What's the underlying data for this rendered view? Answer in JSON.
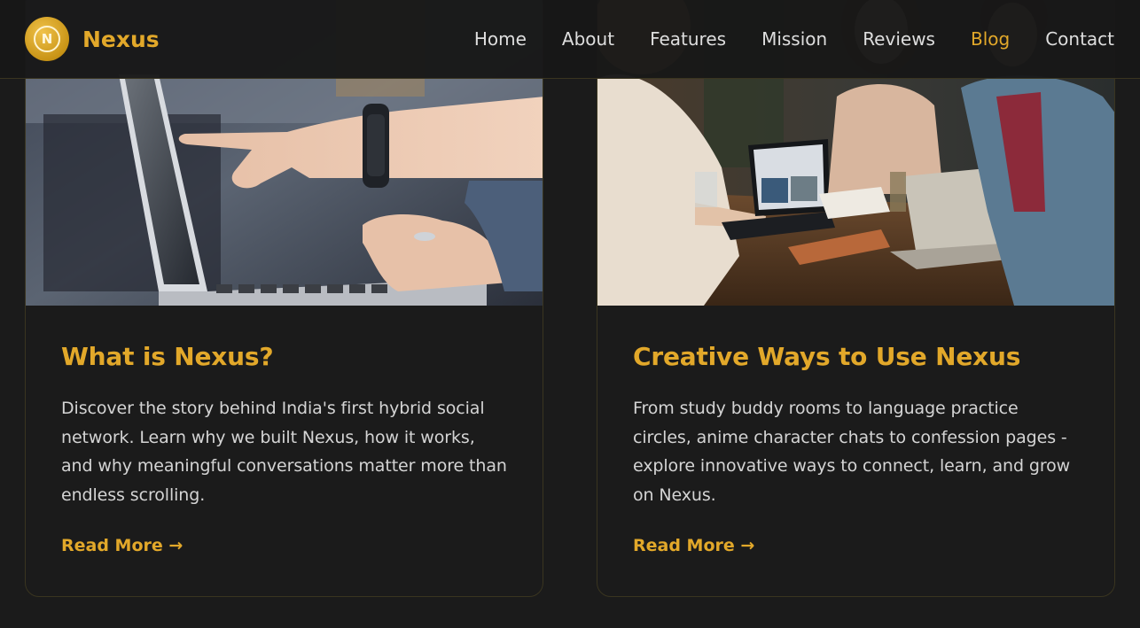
{
  "brand": {
    "logo_letter": "N",
    "name": "Nexus",
    "accent_color": "#e2a82a"
  },
  "nav": {
    "items": [
      {
        "label": "Home",
        "active": false
      },
      {
        "label": "About",
        "active": false
      },
      {
        "label": "Features",
        "active": false
      },
      {
        "label": "Mission",
        "active": false
      },
      {
        "label": "Reviews",
        "active": false
      },
      {
        "label": "Blog",
        "active": true
      },
      {
        "label": "Contact",
        "active": false
      }
    ]
  },
  "posts": [
    {
      "image": "photo-hands-pointing-at-laptop",
      "title": "What is Nexus?",
      "excerpt": "Discover the story behind India's first hybrid social network. Learn why we built Nexus, how it works, and why meaningful conversations matter more than endless scrolling.",
      "link_label": "Read More →"
    },
    {
      "image": "photo-friends-laughing-with-laptops",
      "title": "Creative Ways to Use Nexus",
      "excerpt": "From study buddy rooms to language practice circles, anime character chats to confession pages - explore innovative ways to connect, learn, and grow on Nexus.",
      "link_label": "Read More →"
    }
  ]
}
